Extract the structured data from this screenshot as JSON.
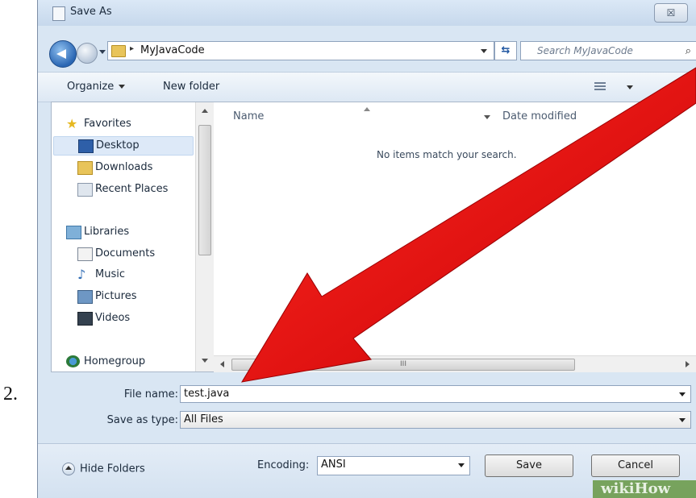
{
  "step_label": "2.",
  "window": {
    "title": "Save As",
    "close_label": "☒"
  },
  "address_bar": {
    "path": "MyJavaCode",
    "separator": "▸"
  },
  "search": {
    "placeholder": "Search MyJavaCode"
  },
  "toolbar": {
    "organize": "Organize",
    "new_folder": "New folder"
  },
  "nav_pane": {
    "favorites": {
      "label": "Favorites",
      "items": [
        "Desktop",
        "Downloads",
        "Recent Places"
      ]
    },
    "libraries": {
      "label": "Libraries",
      "items": [
        "Documents",
        "Music",
        "Pictures",
        "Videos"
      ]
    },
    "homegroup": {
      "label": "Homegroup"
    }
  },
  "file_list": {
    "columns": [
      "Name",
      "Date modified"
    ],
    "empty_message": "No items match your search.",
    "scroll_grip": "III"
  },
  "form": {
    "file_name_label": "File name:",
    "file_name_value": "test.java",
    "save_type_label": "Save as type:",
    "save_type_value": "All Files",
    "encoding_label": "Encoding:",
    "encoding_value": "ANSI"
  },
  "buttons": {
    "hide_folders": "Hide Folders",
    "save": "Save",
    "cancel": "Cancel"
  },
  "watermark": "wikiHow",
  "colors": {
    "arrow": "#e8080a",
    "accent": "#2a66b3",
    "dialog_bg": "#d9e6f3"
  }
}
